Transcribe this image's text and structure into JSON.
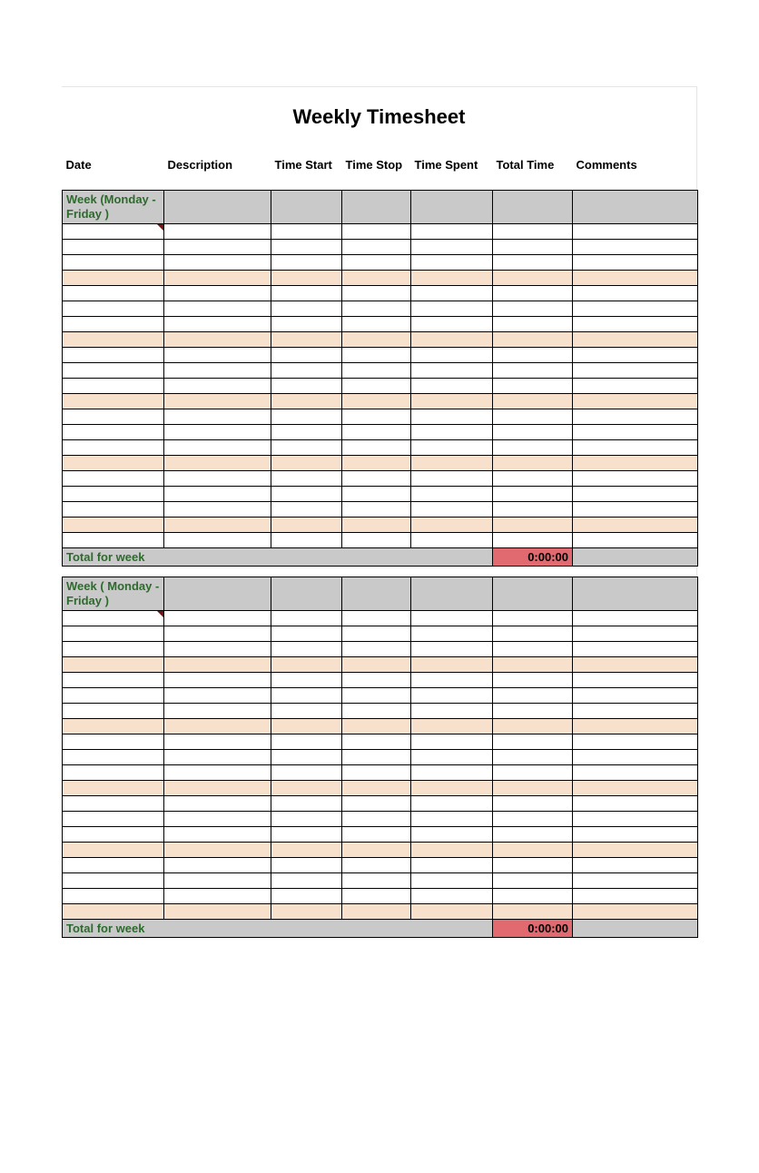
{
  "title": "Weekly Timesheet",
  "columns": {
    "date": "Date",
    "description": "Description",
    "time_start": "Time Start",
    "time_stop": "Time Stop",
    "time_spent": "Time Spent",
    "total_time": "Total Time",
    "comments": "Comments"
  },
  "weeks": [
    {
      "label": "Week  (Monday - Friday )",
      "total_label": "Total for week",
      "total_value": "0:00:00"
    },
    {
      "label": "Week ( Monday - Friday )",
      "total_label": "Total for week",
      "total_value": "0:00:00"
    }
  ]
}
